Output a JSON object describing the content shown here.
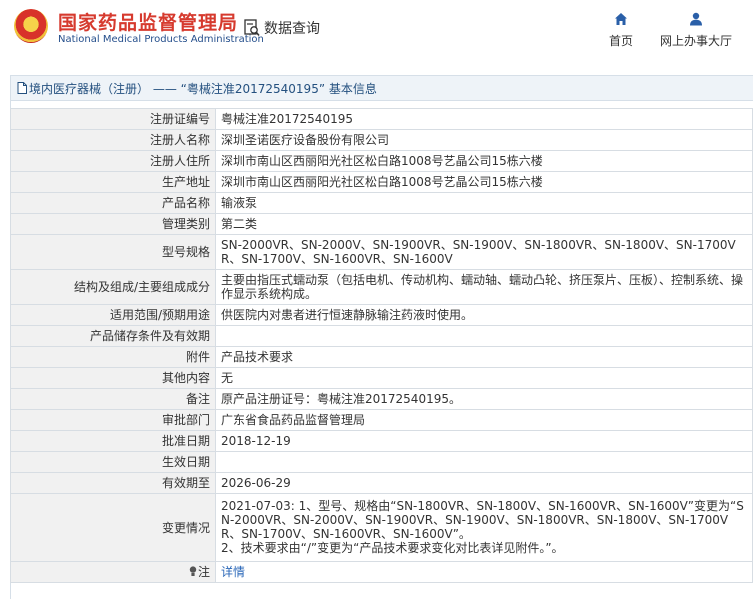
{
  "header": {
    "brand_cn": "国家药品监督管理局",
    "brand_en": "National Medical Products Administration",
    "query_label": "数据查询",
    "nav": [
      {
        "label": "首页",
        "icon": "home-icon"
      },
      {
        "label": "网上办事大厅",
        "icon": "user-icon"
      }
    ]
  },
  "panel": {
    "title": "境内医疗器械（注册） —— “粤械注准20172540195” 基本信息"
  },
  "rows": [
    {
      "key": "注册证编号",
      "value": "粤械注准20172540195"
    },
    {
      "key": "注册人名称",
      "value": "深圳圣诺医疗设备股份有限公司"
    },
    {
      "key": "注册人住所",
      "value": "深圳市南山区西丽阳光社区松白路1008号艺晶公司15栋六楼"
    },
    {
      "key": "生产地址",
      "value": "深圳市南山区西丽阳光社区松白路1008号艺晶公司15栋六楼"
    },
    {
      "key": "产品名称",
      "value": "输液泵"
    },
    {
      "key": "管理类别",
      "value": "第二类"
    },
    {
      "key": "型号规格",
      "value": "SN-2000VR、SN-2000V、SN-1900VR、SN-1900V、SN-1800VR、SN-1800V、SN-1700VR、SN-1700V、SN-1600VR、SN-1600V"
    },
    {
      "key": "结构及组成/主要组成成分",
      "value": "主要由指压式蠕动泵（包括电机、传动机构、蠕动轴、蠕动凸轮、挤压泵片、压板）、控制系统、操作显示系统构成。"
    },
    {
      "key": "适用范围/预期用途",
      "value": "供医院内对患者进行恒速静脉输注药液时使用。"
    },
    {
      "key": "产品储存条件及有效期",
      "value": ""
    },
    {
      "key": "附件",
      "value": "产品技术要求"
    },
    {
      "key": "其他内容",
      "value": "无"
    },
    {
      "key": "备注",
      "value": "原产品注册证号：粤械注准20172540195。"
    },
    {
      "key": "审批部门",
      "value": "广东省食品药品监督管理局"
    },
    {
      "key": "批准日期",
      "value": "2018-12-19"
    },
    {
      "key": "生效日期",
      "value": ""
    },
    {
      "key": "有效期至",
      "value": "2026-06-29"
    }
  ],
  "change": {
    "key": "变更情况",
    "line1": "2021-07-03: 1、型号、规格由“SN-1800VR、SN-1800V、SN-1600VR、SN-1600V”变更为“SN-2000VR、SN-2000V、SN-1900VR、SN-1900V、SN-1800VR、SN-1800V、SN-1700VR、SN-1700V、SN-1600VR、SN-1600V”。",
    "line2": "2、技术要求由“/”变更为“产品技术要求变化对比表详见附件。”。"
  },
  "note": {
    "key": "注",
    "link": "详情",
    "icon": "bulb-icon"
  },
  "colors": {
    "brand_red": "#d63a2e",
    "brand_blue": "#254f8c",
    "title_bar": "#eef3f8",
    "key_cell": "#f1f1f1",
    "link": "#2a67b8"
  }
}
